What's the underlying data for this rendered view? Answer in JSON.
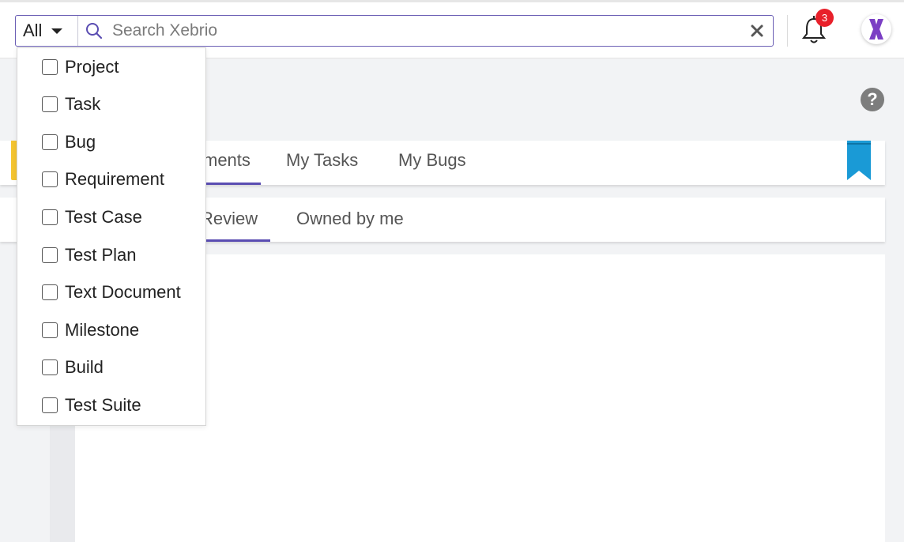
{
  "search": {
    "filter_value": "All",
    "placeholder": "Search Xebrio"
  },
  "notifications": {
    "count": "3"
  },
  "tabs_primary": [
    {
      "label": "Documents",
      "visible_label": "ments",
      "active": true
    },
    {
      "label": "My Tasks",
      "active": false
    },
    {
      "label": "My Bugs",
      "active": false
    }
  ],
  "tabs_secondary": [
    {
      "label": "Review",
      "active": true
    },
    {
      "label": "Owned by me",
      "active": false
    }
  ],
  "filter_dropdown": {
    "items": [
      {
        "label": "Project",
        "checked": false
      },
      {
        "label": "Task",
        "checked": false
      },
      {
        "label": "Bug",
        "checked": false
      },
      {
        "label": "Requirement",
        "checked": false
      },
      {
        "label": "Test Case",
        "checked": false
      },
      {
        "label": "Test Plan",
        "checked": false
      },
      {
        "label": "Text Document",
        "checked": false
      },
      {
        "label": "Milestone",
        "checked": false
      },
      {
        "label": "Build",
        "checked": false
      },
      {
        "label": "Test Suite",
        "checked": false
      }
    ]
  },
  "icons": {
    "search": "search-icon",
    "clear": "close-icon",
    "notifications": "bell-icon",
    "help": "question-circle-icon",
    "bookmark": "bookmark-icon",
    "logo": "xebrio-logo-icon"
  },
  "colors": {
    "accent": "#5a4db2",
    "badge": "#e8202a",
    "bookmark": "#1a9ad6",
    "yellow_tab": "#f4c430"
  }
}
